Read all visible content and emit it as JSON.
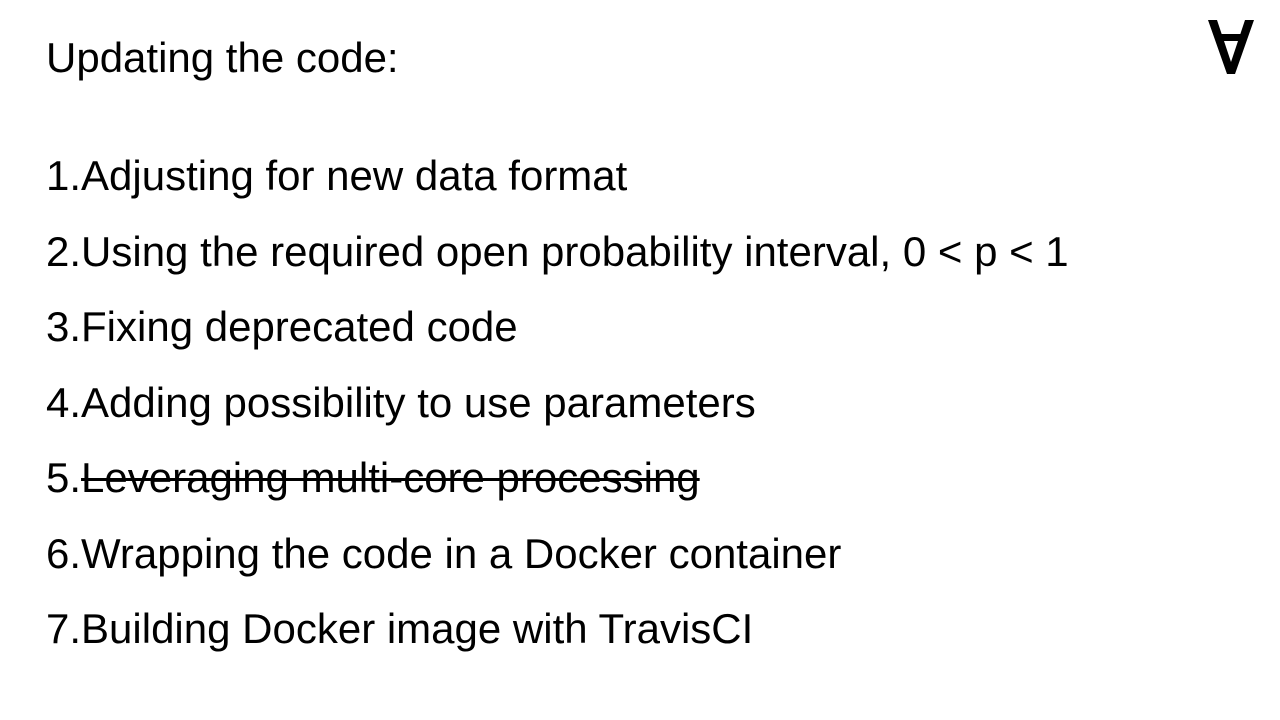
{
  "slide": {
    "title": "Updating the code:"
  },
  "logo": {
    "icon": "inverted-a-logo",
    "color": "#000000"
  },
  "items": [
    {
      "number": "1.",
      "text": "Adjusting for new data format",
      "struck": false
    },
    {
      "number": "2.",
      "text": "Using the required open probability interval, 0 < p < 1",
      "struck": false
    },
    {
      "number": "3.",
      "text": "Fixing deprecated code",
      "struck": false
    },
    {
      "number": "4.",
      "text": "Adding possibility to use parameters",
      "struck": false
    },
    {
      "number": "5.",
      "text": "Leveraging multi-core processing",
      "struck": true
    },
    {
      "number": "6.",
      "text": "Wrapping the code in a Docker container",
      "struck": false
    },
    {
      "number": "7.",
      "text": "Building Docker image with TravisCI",
      "struck": false
    }
  ]
}
